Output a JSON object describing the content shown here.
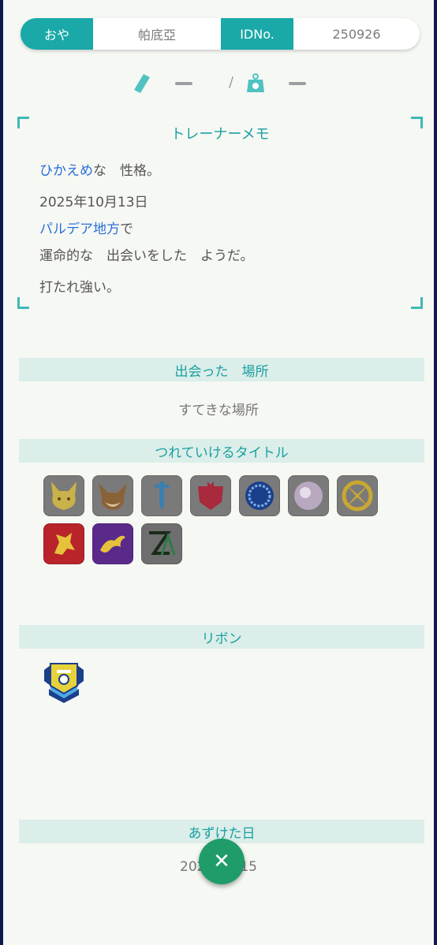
{
  "owner": {
    "ot_label": "おや",
    "ot_value": "帕底亞",
    "id_label": "IDNo.",
    "id_value": "250926"
  },
  "stats": {
    "height": "ー",
    "weight": "ー",
    "separator": "/"
  },
  "memo": {
    "title": "トレーナーメモ",
    "nature_highlight": "ひかえめ",
    "nature_rest": "な　性格。",
    "date": "2025年10月13日",
    "place_highlight": "パルデア地方",
    "place_rest": "で",
    "encounter": "運命的な　出会いをした　ようだ。",
    "characteristic": "打たれ強い。"
  },
  "met_location": {
    "header": "出会った　場所",
    "value": "すてきな場所"
  },
  "titles": {
    "header": "つれていけるタイトル",
    "items": [
      "pikachu-icon",
      "eevee-icon",
      "sword-icon",
      "shield-icon",
      "blue-orb-icon",
      "pearl-orb-icon",
      "gold-emblem-icon",
      "koraidon-icon",
      "miraidon-icon",
      "za-logo-icon"
    ]
  },
  "ribbons": {
    "header": "リボン",
    "items": [
      "pokeball-ribbon-icon"
    ]
  },
  "deposit": {
    "header": "あずけた日",
    "value": "2025/10/15"
  },
  "close_icon": "✕",
  "colors": {
    "accent": "#1aa8a8",
    "highlight": "#2a6fd8",
    "close": "#1f9c6a"
  }
}
